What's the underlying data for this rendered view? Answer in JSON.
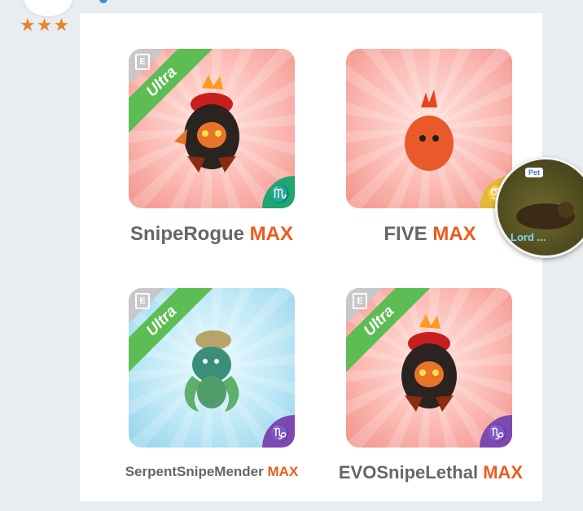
{
  "header": {
    "rating_stars": "★★★"
  },
  "cards": [
    {
      "name": "SnipeRogue",
      "level": "MAX",
      "rarity": "Ultra",
      "zodiac": "♏",
      "zodiac_icon": "scorpio-icon"
    },
    {
      "name": "FIVE",
      "level": "MAX",
      "rarity": "",
      "zodiac": "♋",
      "zodiac_icon": "cancer-icon"
    },
    {
      "name": "SerpentSnipeMender",
      "level": "MAX",
      "rarity": "Ultra",
      "zodiac": "♑",
      "zodiac_icon": "capricorn-icon"
    },
    {
      "name": "EVOSnipeLethal",
      "level": "MAX",
      "rarity": "Ultra",
      "zodiac": "♑",
      "zodiac_icon": "capricorn-icon"
    }
  ],
  "bubble": {
    "tag": "Pet",
    "text": "Lord ..."
  },
  "colors": {
    "max_accent": "#ee5a1d",
    "ultra_ribbon": "#5cbd54",
    "stars": "#e8822b"
  }
}
